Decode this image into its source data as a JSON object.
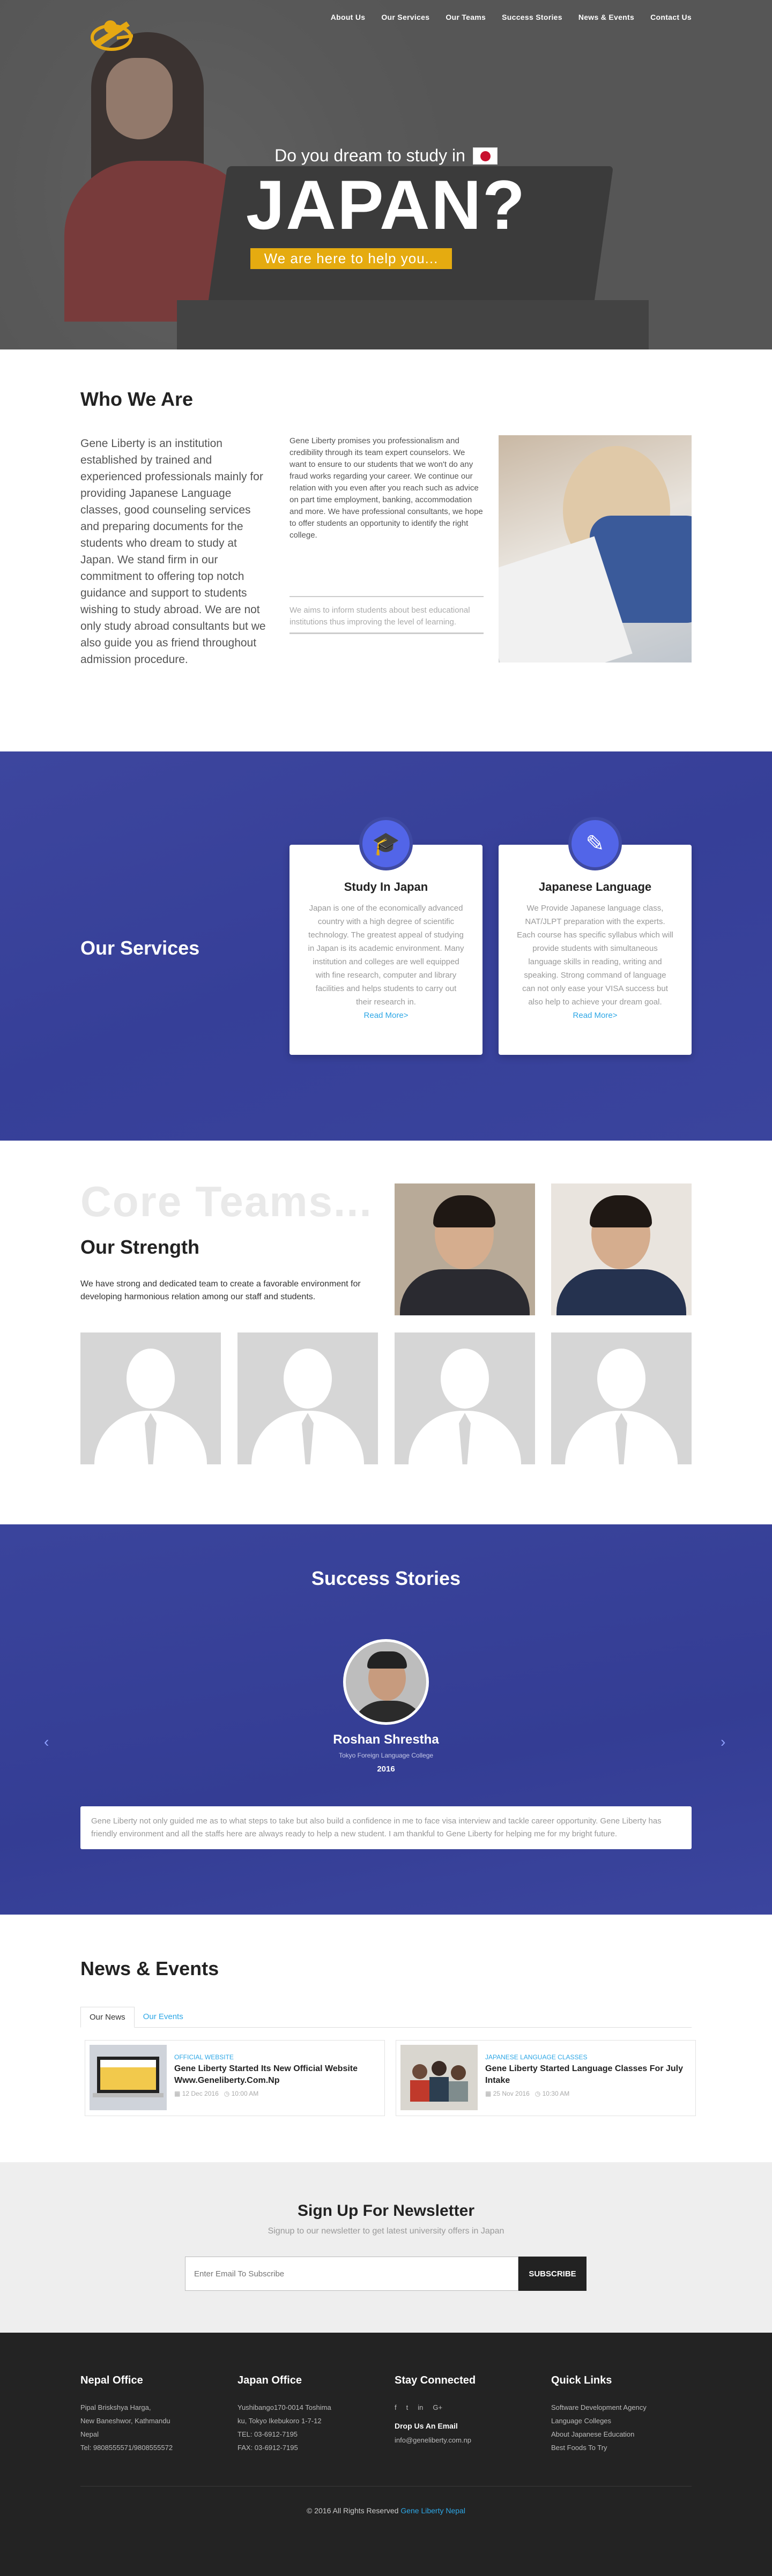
{
  "nav": {
    "items": [
      "About Us",
      "Our Services",
      "Our Teams",
      "Success Stories",
      "News & Events",
      "Contact Us"
    ]
  },
  "hero": {
    "dream_text": "Do you dream to study in",
    "headline": "JAPAN?",
    "tagline": "We are here to help you..."
  },
  "who": {
    "title": "Who We Are",
    "intro": "Gene Liberty is an institution established by trained and experienced professionals mainly for providing Japanese Language classes, good counseling services and preparing documents for the students who dream to study at Japan. We stand firm in our commitment to offering top notch guidance and support to students wishing to study abroad. We are not only study abroad consultants but we also guide you as friend throughout admission procedure.",
    "body": "Gene Liberty promises you professionalism and credibility through its team expert counselors. We want to ensure to our students that we won't do any fraud works regarding your career. We continue our relation with you even after you reach such as advice on part time employment, banking, accommodation and more. We have professional consultants, we hope to offer students an opportunity to identify the right college.",
    "quote": "We aims to inform students about best educational institutions thus improving the level of learning."
  },
  "services": {
    "title": "Our Services",
    "cards": [
      {
        "icon": "graduation-cap-icon",
        "glyph": "🎓",
        "title": "Study In Japan",
        "text": "Japan is one of the economically advanced country with a high degree of scientific technology. The greatest appeal of studying in Japan is its academic environment. Many institution and colleges are well equipped with fine research, computer and library facilities and helps students to carry out their research in.",
        "link": "Read More>"
      },
      {
        "icon": "document-pen-icon",
        "glyph": "✎",
        "title": "Japanese Language",
        "text": "We Provide Japanese language class, NAT/JLPT preparation with the experts. Each course has specific syllabus which will provide students with simultaneous language skills in reading, writing and speaking. Strong command of language can not only ease your VISA success but also help to achieve your dream goal.",
        "link": "Read More>"
      }
    ]
  },
  "strength": {
    "watermark": "Core Teams...",
    "title": "Our Strength",
    "text": "We have strong and dedicated team to create a favorable environment for developing harmonious relation among our staff and students."
  },
  "success": {
    "title": "Success Stories",
    "name": "Roshan Shrestha",
    "school": "Tokyo Foreign Language College",
    "year": "2016",
    "testimonial": "Gene Liberty not only guided me as to what steps to take but also build a confidence in me to face visa interview and tackle career opportunity. Gene Liberty has friendly environment and all the staffs here are always ready to help a new student. I am thankful to Gene Liberty for helping me for my bright future.",
    "prev": "‹",
    "next": "›"
  },
  "news": {
    "title": "News & Events",
    "tabs": [
      "Our News",
      "Our Events"
    ],
    "items": [
      {
        "category": "OFFICIAL WEBSITE",
        "title": "Gene Liberty Started Its New Official Website Www.Geneliberty.Com.Np",
        "date": "12 Dec 2016",
        "time": "10:00 AM"
      },
      {
        "category": "JAPANESE LANGUAGE CLASSES",
        "title": "Gene Liberty Started Language Classes For July Intake",
        "date": "25 Nov 2016",
        "time": "10:30 AM"
      }
    ]
  },
  "newsletter": {
    "title": "Sign Up For Newsletter",
    "subtitle": "Signup to our newsletter to get latest university offers in Japan",
    "placeholder": "Enter Email To Subscribe",
    "button": "SUBSCRIBE"
  },
  "footer": {
    "nepal": {
      "title": "Nepal Office",
      "lines": [
        "Pipal Briskshya Harga,",
        "New Baneshwor, Kathmandu",
        "Nepal",
        "Tel: 9808555571/9808555572"
      ]
    },
    "japan": {
      "title": "Japan Office",
      "lines": [
        "Yushibango170-0014 Toshima",
        "ku, Tokyo Ikebukoro 1-7-12",
        "TEL: 03-6912-7195",
        "FAX: 03-6912-7195"
      ]
    },
    "connect": {
      "title": "Stay Connected",
      "drop": "Drop Us An Email",
      "email": "info@geneliberty.com.np"
    },
    "links": {
      "title": "Quick Links",
      "items": [
        "Software Development Agency",
        "Language Colleges",
        "About Japanese Education",
        "Best Foods To Try"
      ]
    },
    "copyright": "© 2016 All Rights Reserved",
    "brand": "Gene Liberty Nepal"
  },
  "colors": {
    "accent": "#2ea7e6",
    "brand_blue": "#3d469e",
    "highlight": "#e5ab10"
  }
}
